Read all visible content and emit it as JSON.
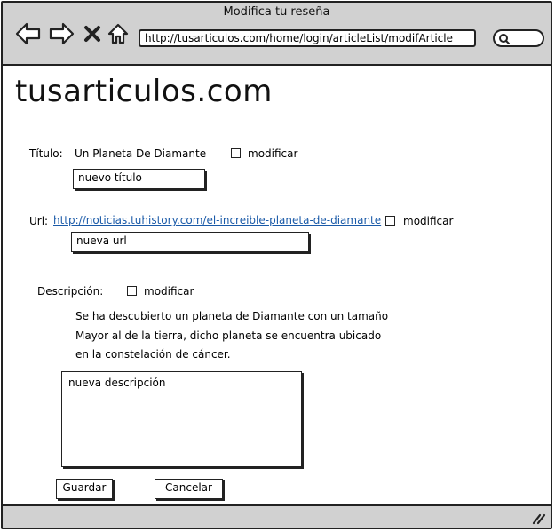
{
  "window": {
    "title": "Modifica tu reseña",
    "url": "http://tusarticulos.com/home/login/articleList/modifArticle"
  },
  "site": {
    "name": "tusarticulos.com"
  },
  "form": {
    "title_label": "Título:",
    "title_value": "Un Planeta De Diamante",
    "title_modify_label": "modificar",
    "title_input_value": "nuevo título",
    "url_label": "Url:",
    "url_value": "http://noticias.tuhistory.com/el-increible-planeta-de-diamante",
    "url_modify_label": "modificar",
    "url_input_value": "nueva url",
    "description_label": "Descripción:",
    "description_modify_label": "modificar",
    "description_lines": [
      "Se ha descubierto un planeta de Diamante con un tamaño",
      "Mayor al de la tierra, dicho planeta se encuentra ubicado",
      "en la constelación de cáncer."
    ],
    "description_input_value": "nueva descripción"
  },
  "buttons": {
    "save": "Guardar",
    "cancel": "Cancelar"
  },
  "colors": {
    "chrome": "#d1d1d1",
    "link": "#1a5aa8",
    "border": "#222222"
  }
}
